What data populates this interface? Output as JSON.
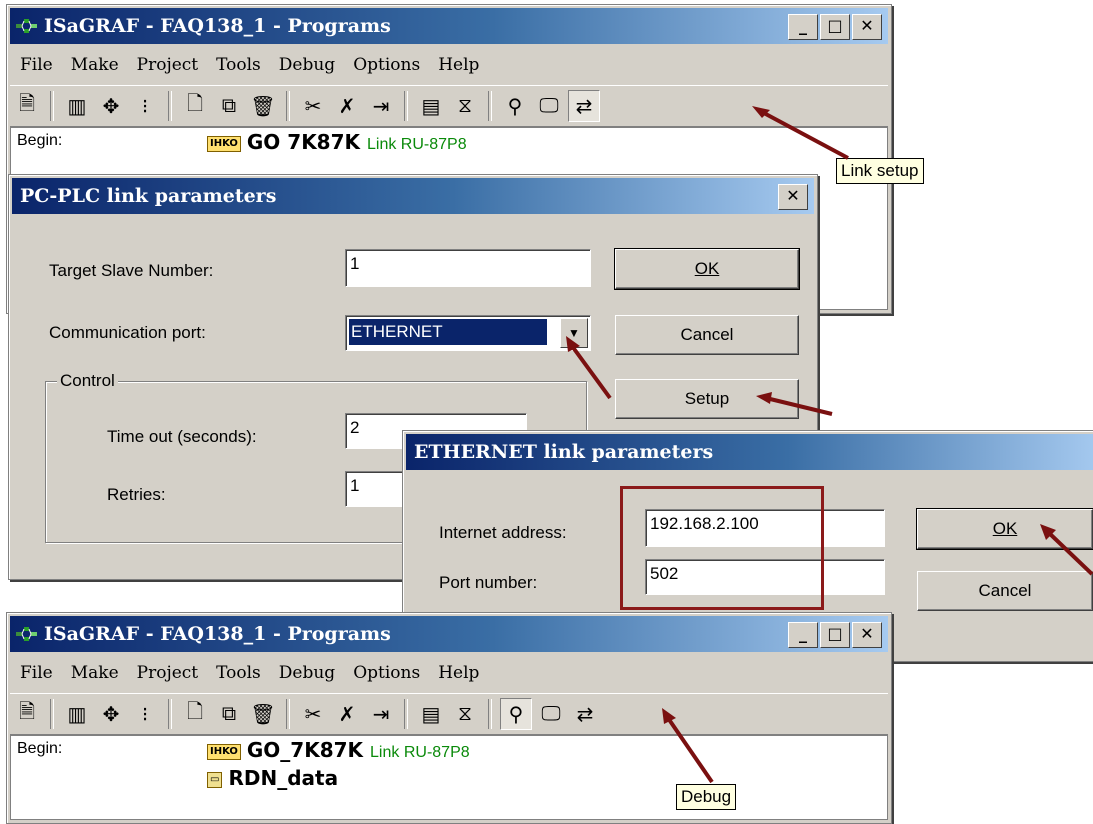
{
  "top_window": {
    "title": "ISaGRAF - FAQ138_1 - Programs",
    "menu": [
      "File",
      "Make",
      "Project",
      "Tools",
      "Debug",
      "Options",
      "Help"
    ],
    "begin_label": "Begin:",
    "program_name": "GO  7K87K",
    "program_link": "Link RU-87P8",
    "tooltip": "Link setup"
  },
  "link_dialog": {
    "title": "PC-PLC link parameters",
    "target_slave_label": "Target Slave Number:",
    "target_slave_value": "1",
    "comm_port_label": "Communication port:",
    "comm_port_value": "ETHERNET",
    "control_group": "Control",
    "timeout_label": "Time out (seconds):",
    "timeout_value": "2",
    "retries_label": "Retries:",
    "retries_value": "1",
    "ok": "OK",
    "cancel": "Cancel",
    "setup": "Setup"
  },
  "ethernet_dialog": {
    "title": "ETHERNET link parameters",
    "address_label": "Internet address:",
    "address_value": "192.168.2.100",
    "port_label": "Port number:",
    "port_value": "502",
    "ok": "OK",
    "cancel": "Cancel"
  },
  "bottom_window": {
    "title": "ISaGRAF - FAQ138_1 - Programs",
    "menu": [
      "File",
      "Make",
      "Project",
      "Tools",
      "Debug",
      "Options",
      "Help"
    ],
    "begin_label": "Begin:",
    "program1_name": "GO_7K87K",
    "program1_link": "Link RU-87P8",
    "program2_name": "RDN_data",
    "tooltip": "Debug"
  },
  "colors": {
    "titlebar_start": "#0a246a",
    "titlebar_end": "#a6caf0",
    "arrow": "#7a1010",
    "link_text": "#0a8a0a"
  }
}
